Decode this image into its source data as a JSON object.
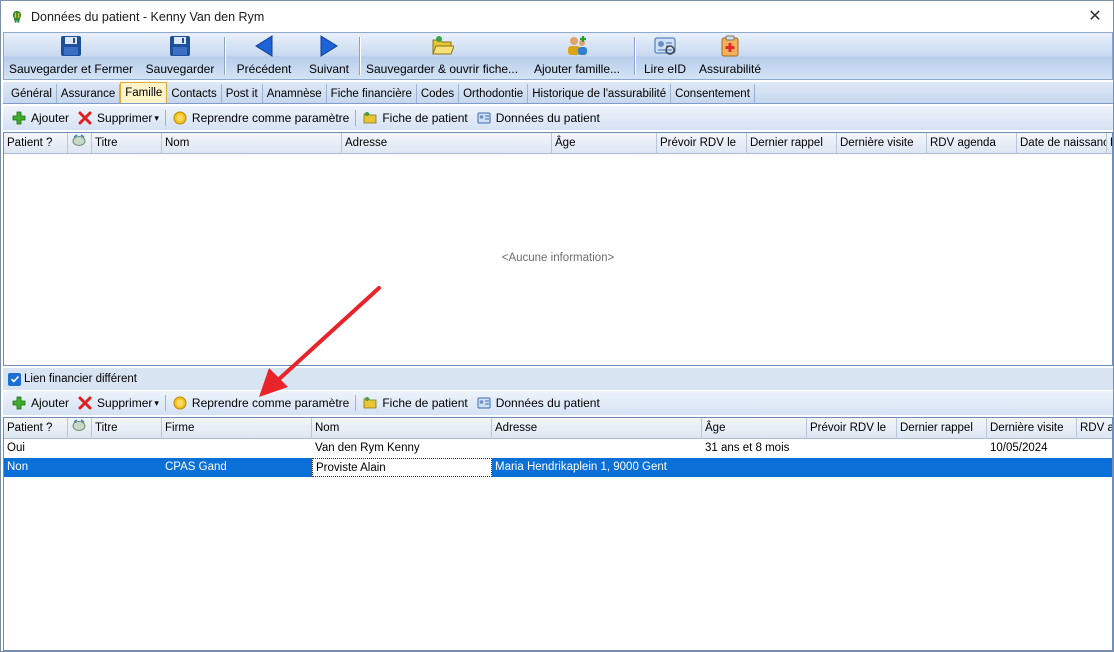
{
  "window": {
    "title": "Données du patient - Kenny Van den Rym",
    "close_glyph": "✕"
  },
  "toolbar": {
    "buttons": [
      {
        "label": "Sauvegarder et Fermer",
        "icon": "save-icon"
      },
      {
        "label": "Sauvegarder",
        "icon": "save-icon"
      },
      {
        "label": "Précédent",
        "icon": "arrow-left-icon"
      },
      {
        "label": "Suivant",
        "icon": "arrow-right-icon"
      },
      {
        "label": "Sauvegarder & ouvrir fiche...",
        "icon": "folder-open-icon"
      },
      {
        "label": "Ajouter famille...",
        "icon": "add-family-icon"
      },
      {
        "label": "Lire eID",
        "icon": "eid-card-icon"
      },
      {
        "label": "Assurabilité",
        "icon": "medical-kit-icon"
      }
    ]
  },
  "tabs": [
    "Général",
    "Assurance",
    "Famille",
    "Contacts",
    "Post it",
    "Anamnèse",
    "Fiche financière",
    "Codes",
    "Orthodontie",
    "Historique de l'assurabilité",
    "Consentement"
  ],
  "active_tab": "Famille",
  "actions": {
    "add": "Ajouter",
    "delete": "Supprimer",
    "dropdown_glyph": "▾",
    "reuse": "Reprendre comme paramètre",
    "patient_file": "Fiche de patient",
    "patient_data": "Données du patient"
  },
  "family_grid": {
    "headers": [
      "Patient ?",
      "",
      "Titre",
      "Nom",
      "Adresse",
      "Âge",
      "Prévoir RDV le",
      "Dernier rappel",
      "Dernière visite",
      "RDV agenda",
      "Date de naissance",
      "F"
    ],
    "empty_text": "<Aucune information>"
  },
  "financial_link": {
    "label": "Lien financier différent",
    "checked": true
  },
  "financial_grid": {
    "headers": [
      "Patient ?",
      "",
      "Titre",
      "Firme",
      "Nom",
      "Adresse",
      "Âge",
      "Prévoir RDV le",
      "Dernier rappel",
      "Dernière visite",
      "RDV ag"
    ],
    "rows": [
      [
        "Oui",
        "",
        "",
        "",
        "Van den Rym Kenny",
        "",
        "31 ans et 8 mois",
        "",
        "",
        "10/05/2024",
        ""
      ],
      [
        "Non",
        "",
        "",
        "CPAS Gand",
        "Proviste Alain",
        "Maria Hendrikaplein 1, 9000 Gent",
        "",
        "",
        "",
        "",
        ""
      ]
    ],
    "selected_row": 1
  },
  "colors": {
    "selection": "#0a6fd6",
    "annotation_arrow": "#e8232a",
    "active_tab": "#fff3c8"
  }
}
